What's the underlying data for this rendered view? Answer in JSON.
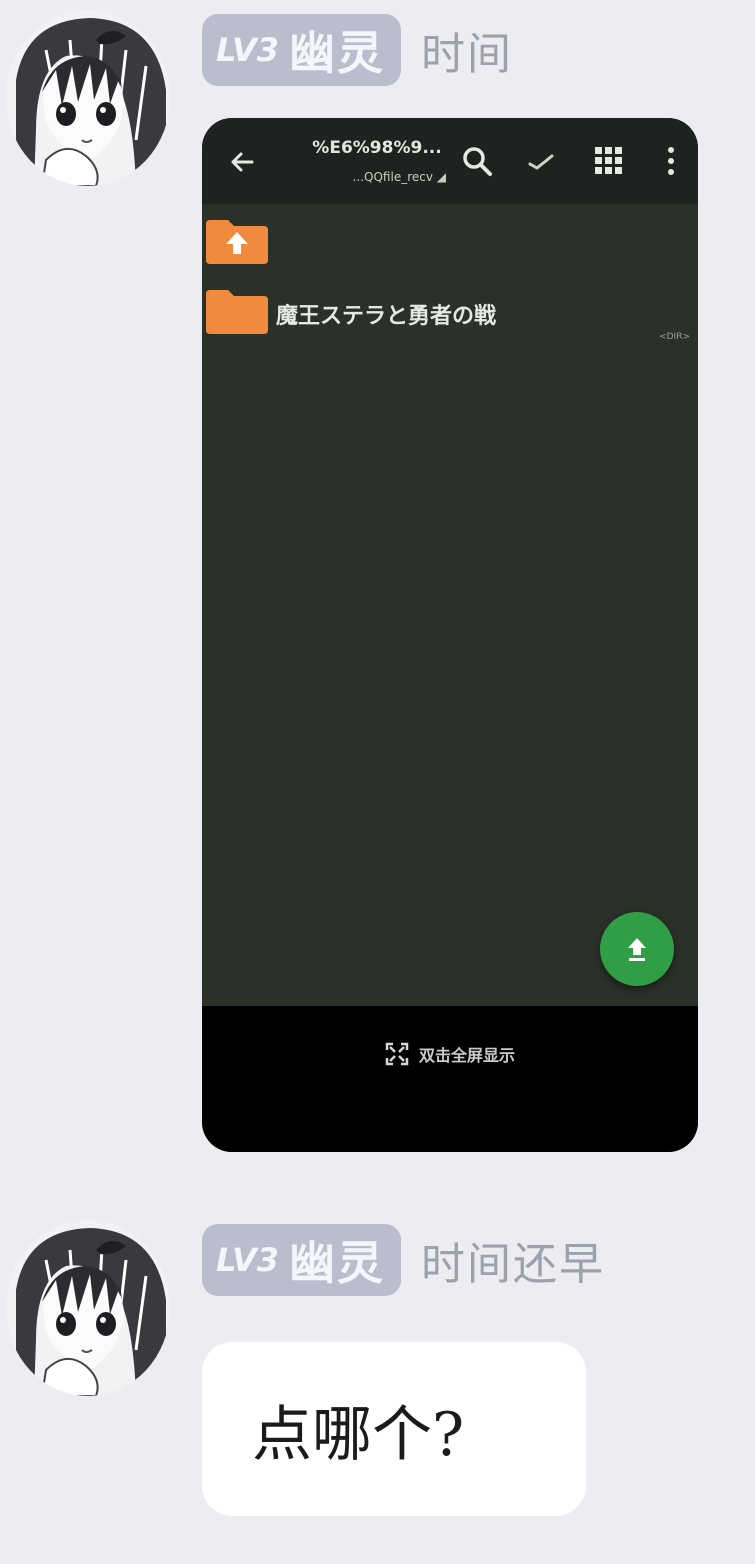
{
  "messages": [
    {
      "sender": {
        "level": "LV3",
        "name": "幽灵",
        "title": "时间"
      },
      "screenshot": {
        "path": "%E6%98%9...",
        "subpath": "...QQfile_recv ◢",
        "icons": {
          "back": "back-arrow-icon",
          "search": "search-icon",
          "select": "check-icon",
          "view": "grid-view-icon",
          "more": "more-vertical-icon",
          "fab": "upload-icon",
          "bottom": "fullscreen-icon"
        },
        "folders": [
          {
            "label": ""
          },
          {
            "label": "魔王ステラと勇者の戦",
            "meta": "<DIR>"
          }
        ],
        "bottom_label": "双击全屏显示",
        "colors": {
          "background": "#2b3029",
          "toolbar": "#1f231f",
          "folder": "#f08a3c",
          "fab": "#2f9e44",
          "bottom_bar": "#000000"
        }
      }
    },
    {
      "sender": {
        "level": "LV3",
        "name": "幽灵",
        "title": "时间还早"
      },
      "text": "点哪个?"
    }
  ],
  "colors": {
    "page_background": "#ececf1",
    "badge_background": "#b9bdcc",
    "title_text": "#9da1ae",
    "bubble": "#ffffff"
  }
}
